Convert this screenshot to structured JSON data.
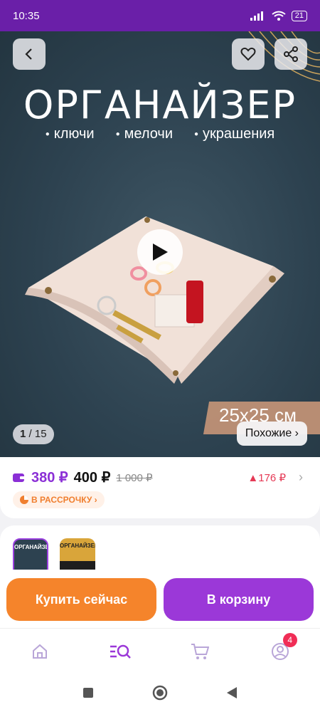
{
  "status": {
    "time": "10:35",
    "signal": "4G",
    "battery": "21"
  },
  "hero": {
    "title": "ОРГАНАЙЗЕР",
    "bullets": [
      "ключи",
      "мелочи",
      "украшения"
    ],
    "size_label": "25x25 см",
    "counter_current": "1",
    "counter_total": "15",
    "similar_label": "Похожие ›"
  },
  "price": {
    "wallet_price": "380 ₽",
    "price": "400 ₽",
    "old_price": "1 000 ₽",
    "delta": "▲176 ₽",
    "installment_label": "В РАССРОЧКУ ›"
  },
  "variants": [
    {
      "label": "ОРГАНАЙЗЕР",
      "color": "#2d4250",
      "selected": true
    },
    {
      "label": "ОРГАНАЙЗЕР",
      "color": "#d9a53a",
      "selected": false
    }
  ],
  "actions": {
    "buy_now": "Купить сейчас",
    "add_to_cart": "В корзину"
  },
  "tabs": {
    "profile_badge": "4"
  },
  "colors": {
    "accent": "#9b40e0",
    "buy": "#f5842b",
    "cart": "#9b38d8",
    "status_bar": "#6a1fa8"
  }
}
